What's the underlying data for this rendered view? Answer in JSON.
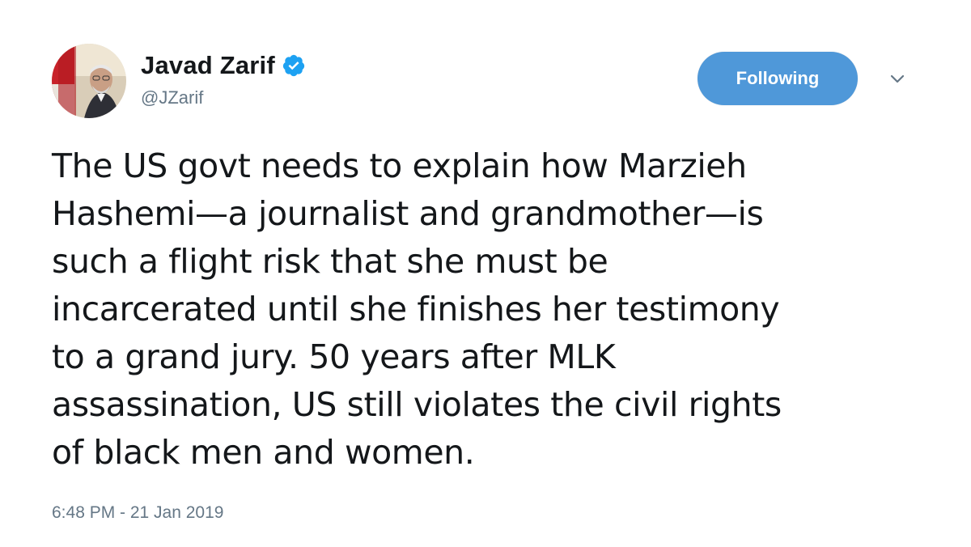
{
  "user": {
    "display_name": "Javad Zarif",
    "handle": "@JZarif",
    "verified": true,
    "avatar_icon": "profile-photo"
  },
  "actions": {
    "follow_label": "Following",
    "follow_color": "#4f98d9",
    "more_icon": "chevron-down-icon"
  },
  "tweet": {
    "lines": [
      "The US govt needs to explain how Marzieh",
      "Hashemi—a journalist and grandmother—is",
      "such a flight risk that she must be",
      "incarcerated until she finishes her testimony",
      "to a grand jury. 50 years after MLK",
      "assassination, US still violates the civil rights",
      "of black men and women."
    ],
    "timestamp": "6:48 PM - 21 Jan 2019"
  },
  "colors": {
    "verified_blue": "#1da1f2",
    "secondary_text": "#657786",
    "primary_text": "#14171a"
  }
}
